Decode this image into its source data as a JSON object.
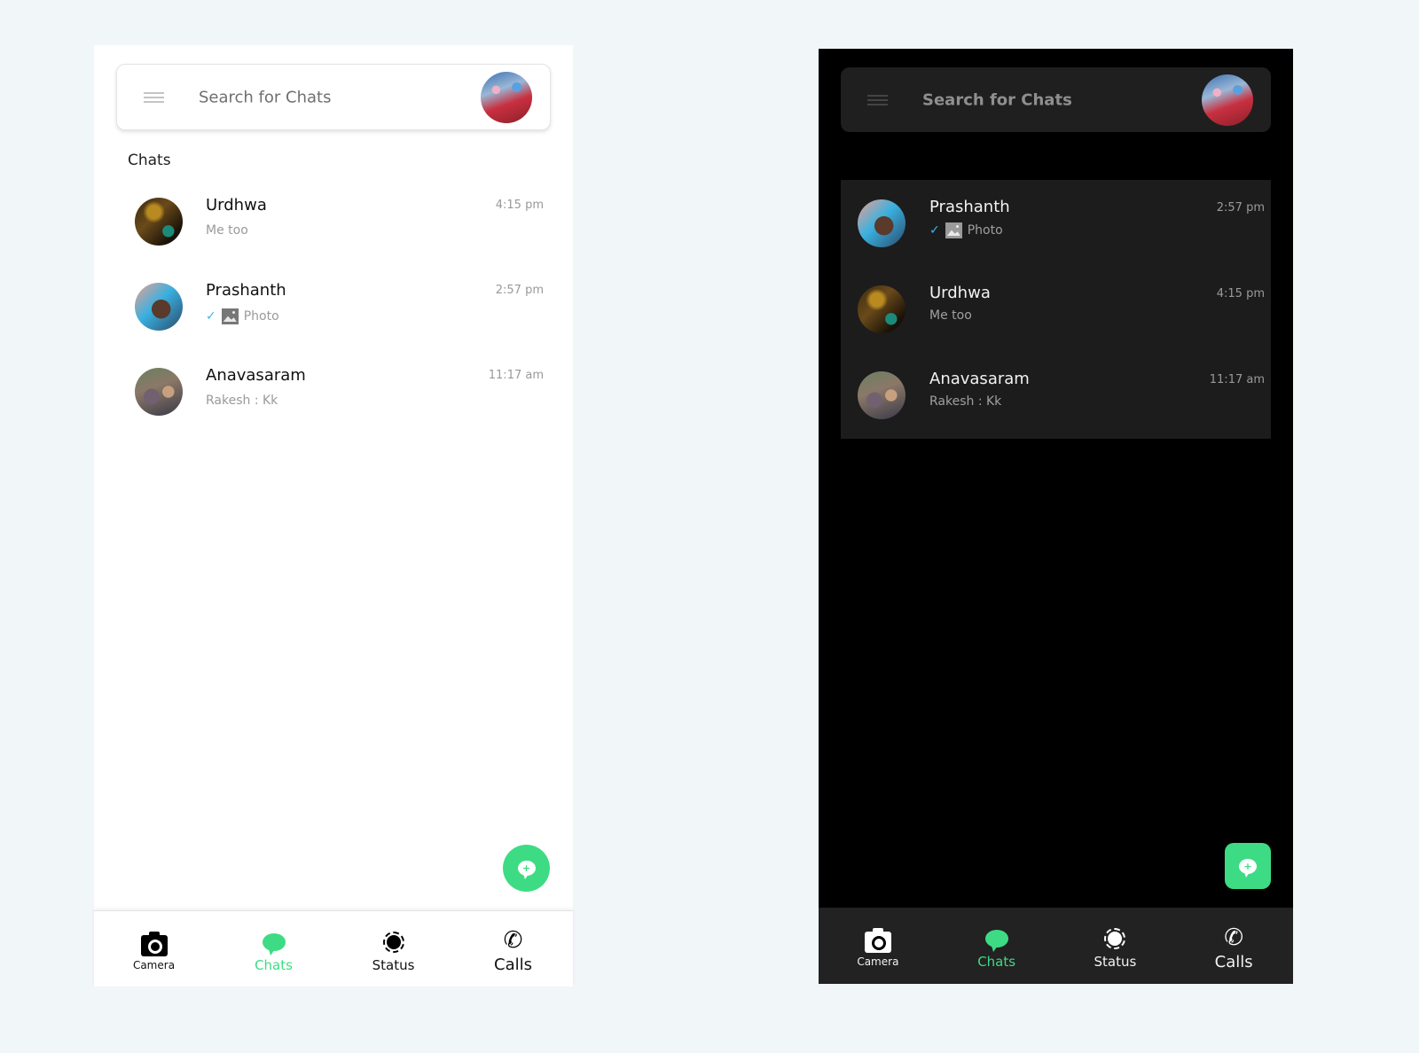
{
  "search": {
    "placeholder": "Search for Chats"
  },
  "light": {
    "section_title": "Chats",
    "chats": [
      {
        "name": "Urdhwa",
        "preview": "Me too",
        "time": "4:15 pm",
        "avatar": "urdhwa"
      },
      {
        "name": "Prashanth",
        "preview": "Photo",
        "time": "2:57 pm",
        "avatar": "prashanth",
        "read_ticks": true,
        "media": "photo"
      },
      {
        "name": "Anavasaram",
        "preview": "Rakesh : Kk",
        "time": "11:17 am",
        "avatar": "anavasaram"
      }
    ]
  },
  "dark": {
    "chats": [
      {
        "name": "Prashanth",
        "preview": "Photo",
        "time": "2:57 pm",
        "avatar": "prashanth",
        "read_ticks": true,
        "media": "photo"
      },
      {
        "name": "Urdhwa",
        "preview": "Me too",
        "time": "4:15 pm",
        "avatar": "urdhwa"
      },
      {
        "name": "Anavasaram",
        "preview": "Rakesh : Kk",
        "time": "11:17 am",
        "avatar": "anavasaram"
      }
    ]
  },
  "fab": {
    "icon": "new-chat-icon",
    "glyph": "+"
  },
  "nav": {
    "items": [
      {
        "label": "Camera",
        "icon": "camera-icon"
      },
      {
        "label": "Chats",
        "icon": "chat-bubble-icon",
        "active": true
      },
      {
        "label": "Status",
        "icon": "status-icon"
      },
      {
        "label": "Calls",
        "icon": "phone-icon",
        "glyph": "✆"
      }
    ]
  },
  "colors": {
    "accent": "#3ddc84",
    "read_tick": "#3fb6e8",
    "dark_surface": "#1c1c1c",
    "page_bg": "#f1f6f9"
  }
}
